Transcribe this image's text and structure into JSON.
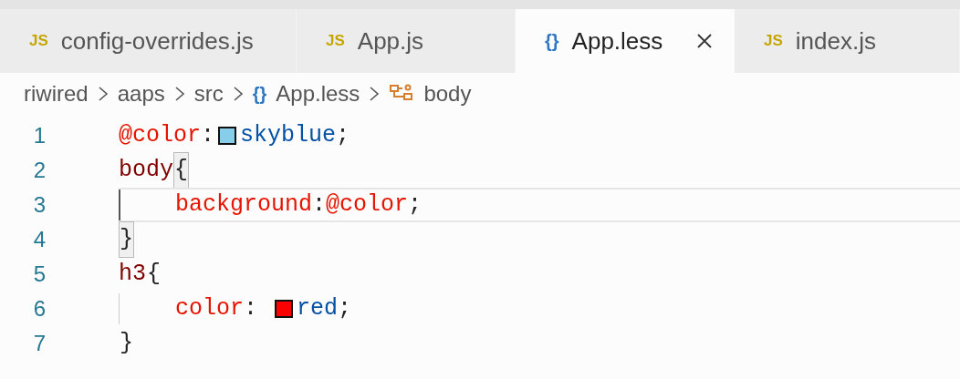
{
  "tabs": [
    {
      "icon": "JS",
      "kind": "js",
      "label": "config-overrides.js",
      "selected": false
    },
    {
      "icon": "JS",
      "kind": "js",
      "label": "App.js",
      "selected": false
    },
    {
      "icon": "{}",
      "kind": "less",
      "label": "App.less",
      "selected": true
    },
    {
      "icon": "JS",
      "kind": "js",
      "label": "index.js",
      "selected": false
    }
  ],
  "breadcrumbs": [
    {
      "kind": "folder",
      "label": "riwired"
    },
    {
      "kind": "folder",
      "label": "aaps"
    },
    {
      "kind": "folder",
      "label": "src"
    },
    {
      "kind": "file",
      "icon": "{}",
      "label": "App.less"
    },
    {
      "kind": "symbol",
      "label": "body"
    }
  ],
  "lines": [
    {
      "number": "1",
      "current": false,
      "tokens": [
        {
          "kind": "variable",
          "text": "@color"
        },
        {
          "kind": "punct",
          "text": ":"
        },
        {
          "kind": "swatch",
          "color": "#87ceeb"
        },
        {
          "kind": "value",
          "text": "skyblue"
        },
        {
          "kind": "punct",
          "text": ";"
        }
      ]
    },
    {
      "number": "2",
      "current": false,
      "tokens": [
        {
          "kind": "selector",
          "text": "body"
        },
        {
          "kind": "bracket",
          "text": "{",
          "matched": true
        }
      ]
    },
    {
      "number": "3",
      "current": true,
      "tokens": [
        {
          "kind": "indent",
          "active": true
        },
        {
          "kind": "property",
          "text": "background"
        },
        {
          "kind": "punct",
          "text": ":"
        },
        {
          "kind": "variable",
          "text": "@color"
        },
        {
          "kind": "punct",
          "text": ";"
        }
      ]
    },
    {
      "number": "4",
      "current": false,
      "tokens": [
        {
          "kind": "bracket",
          "text": "}",
          "matched": true
        }
      ]
    },
    {
      "number": "5",
      "current": false,
      "tokens": [
        {
          "kind": "selector",
          "text": "h3"
        },
        {
          "kind": "bracket",
          "text": "{",
          "matched": false
        }
      ]
    },
    {
      "number": "6",
      "current": false,
      "tokens": [
        {
          "kind": "indent",
          "active": false
        },
        {
          "kind": "property",
          "text": "color"
        },
        {
          "kind": "punct",
          "text": ": "
        },
        {
          "kind": "swatch",
          "color": "#ff0000"
        },
        {
          "kind": "value",
          "text": "red"
        },
        {
          "kind": "punct",
          "text": ";"
        }
      ]
    },
    {
      "number": "7",
      "current": false,
      "tokens": [
        {
          "kind": "bracket",
          "text": "}",
          "matched": false
        }
      ]
    }
  ]
}
